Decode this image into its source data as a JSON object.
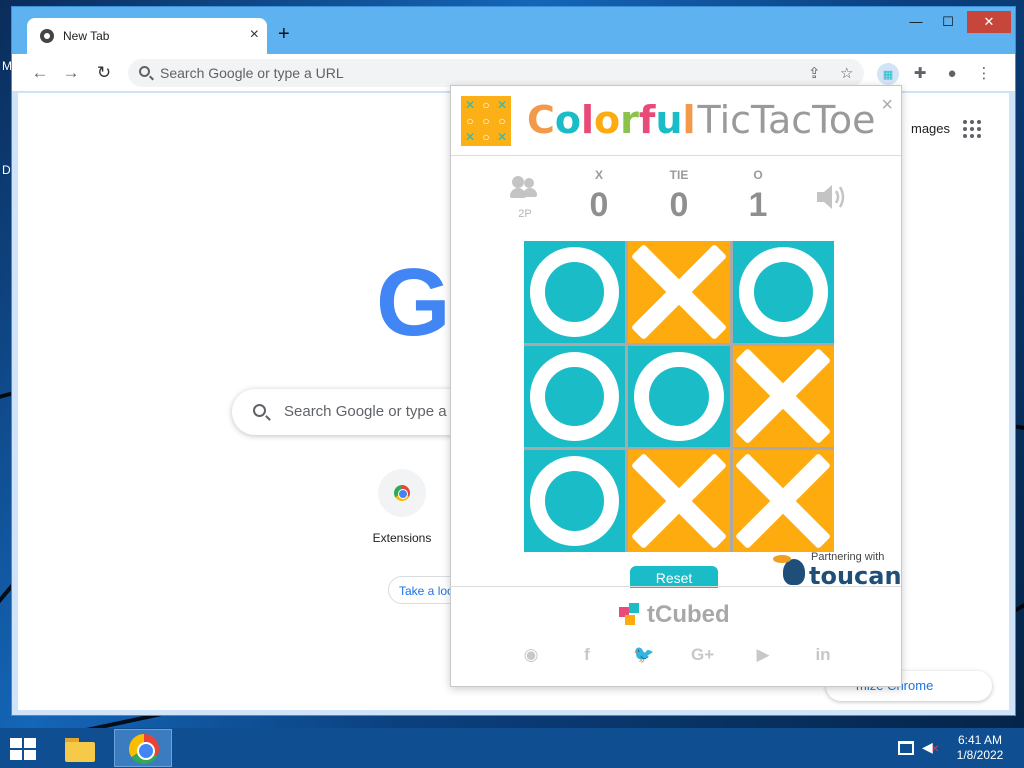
{
  "desktop": {
    "left_chars": [
      "M",
      "D"
    ]
  },
  "browser": {
    "tab_title": "New Tab",
    "new_tab_symbol": "+",
    "window_controls": {
      "minimize": "—",
      "maximize": "☐",
      "close": "✕"
    },
    "omnibox_placeholder": "Search Google or type a URL"
  },
  "newtab": {
    "logo_visible": "Go",
    "search_placeholder": "Search Google or type a",
    "shortcut_label": "Extensions",
    "take_look": "Take a loo",
    "images_link": "mages",
    "customize": "mize Chrome"
  },
  "extension": {
    "title_colorful": [
      "C",
      "o",
      "l",
      "o",
      "r",
      "f",
      "u",
      "l"
    ],
    "title_colors": [
      "#f2994a",
      "#1abcc8",
      "#e84b7a",
      "#fdab0f",
      "#8bc34a",
      "#e84b7a",
      "#1abcc8",
      "#f2994a"
    ],
    "title_rest": "TicTacToe",
    "close_symbol": "×",
    "mode_label": "2P",
    "score": {
      "x_label": "X",
      "x_value": "0",
      "tie_label": "TIE",
      "tie_value": "0",
      "o_label": "O",
      "o_value": "1"
    },
    "board": [
      "O",
      "X",
      "O",
      "O",
      "O",
      "X",
      "O",
      "X",
      "X"
    ],
    "colors": {
      "O": "#1abcc8",
      "X": "#fdab0f"
    },
    "reset_label": "Reset",
    "partner_text": "Partnering with",
    "partner_brand": "toucan",
    "footer_brand": "tCubed",
    "social": [
      {
        "name": "globe-icon",
        "glyph": "◉"
      },
      {
        "name": "facebook-icon",
        "glyph": "f"
      },
      {
        "name": "twitter-icon",
        "glyph": "🐦"
      },
      {
        "name": "google-plus-icon",
        "glyph": "G+"
      },
      {
        "name": "youtube-icon",
        "glyph": "▶"
      },
      {
        "name": "linkedin-icon",
        "glyph": "in"
      }
    ]
  },
  "taskbar": {
    "time": "6:41 AM",
    "date": "1/8/2022"
  }
}
